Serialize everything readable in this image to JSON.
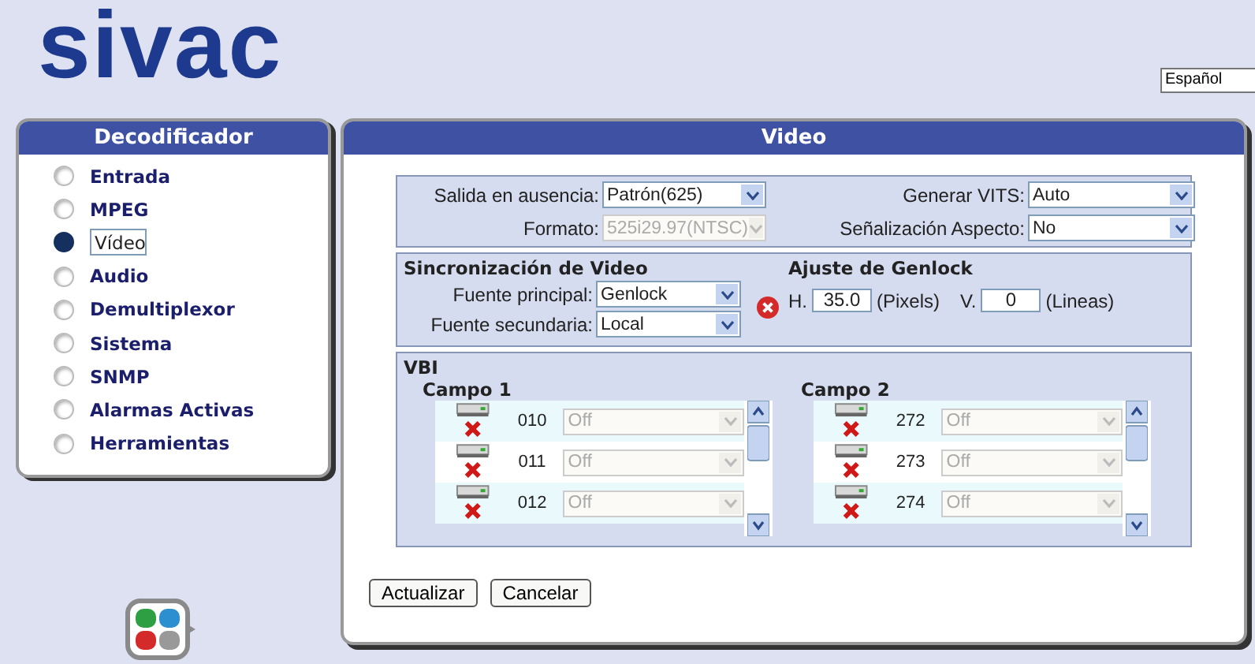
{
  "logo": "sivac",
  "language": {
    "value": "Español"
  },
  "sidebar": {
    "title": "Decodificador",
    "items": [
      {
        "label": "Entrada",
        "selected": false
      },
      {
        "label": "MPEG",
        "selected": false
      },
      {
        "label": "Vídeo",
        "selected": true
      },
      {
        "label": "Audio",
        "selected": false
      },
      {
        "label": "Demultiplexor",
        "selected": false
      },
      {
        "label": "Sistema",
        "selected": false
      },
      {
        "label": "SNMP",
        "selected": false
      },
      {
        "label": "Alarmas Activas",
        "selected": false
      },
      {
        "label": "Herramientas",
        "selected": false
      }
    ]
  },
  "panel": {
    "title": "Video",
    "general": {
      "left": [
        {
          "label": "Salida en ausencia:",
          "value": "Patrón(625)",
          "disabled": false
        },
        {
          "label": "Formato:",
          "value": "525i29.97(NTSC)",
          "disabled": true
        }
      ],
      "right": [
        {
          "label": "Generar VITS:",
          "value": "Auto",
          "disabled": false
        },
        {
          "label": "Señalización Aspecto:",
          "value": "No",
          "disabled": false
        }
      ]
    },
    "sync": {
      "title": "Sincronización de Video",
      "fields": [
        {
          "label": "Fuente principal:",
          "value": "Genlock",
          "disabled": false
        },
        {
          "label": "Fuente secundaria:",
          "value": "Local",
          "disabled": false
        }
      ],
      "error": true
    },
    "genlock": {
      "title": "Ajuste de Genlock",
      "h_label": "H.",
      "h_value": "35.0",
      "h_unit": "(Pixels)",
      "v_label": "V.",
      "v_value": "0",
      "v_unit": "(Lineas)"
    },
    "vbi": {
      "title": "VBI",
      "fields": [
        {
          "title": "Campo 1",
          "rows": [
            {
              "line": "010",
              "value": "Off",
              "disabled": true
            },
            {
              "line": "011",
              "value": "Off",
              "disabled": true
            },
            {
              "line": "012",
              "value": "Off",
              "disabled": true
            }
          ]
        },
        {
          "title": "Campo 2",
          "rows": [
            {
              "line": "272",
              "value": "Off",
              "disabled": true
            },
            {
              "line": "273",
              "value": "Off",
              "disabled": true
            },
            {
              "line": "274",
              "value": "Off",
              "disabled": true
            }
          ]
        }
      ]
    },
    "buttons": [
      "Actualizar",
      "Cancelar"
    ]
  }
}
